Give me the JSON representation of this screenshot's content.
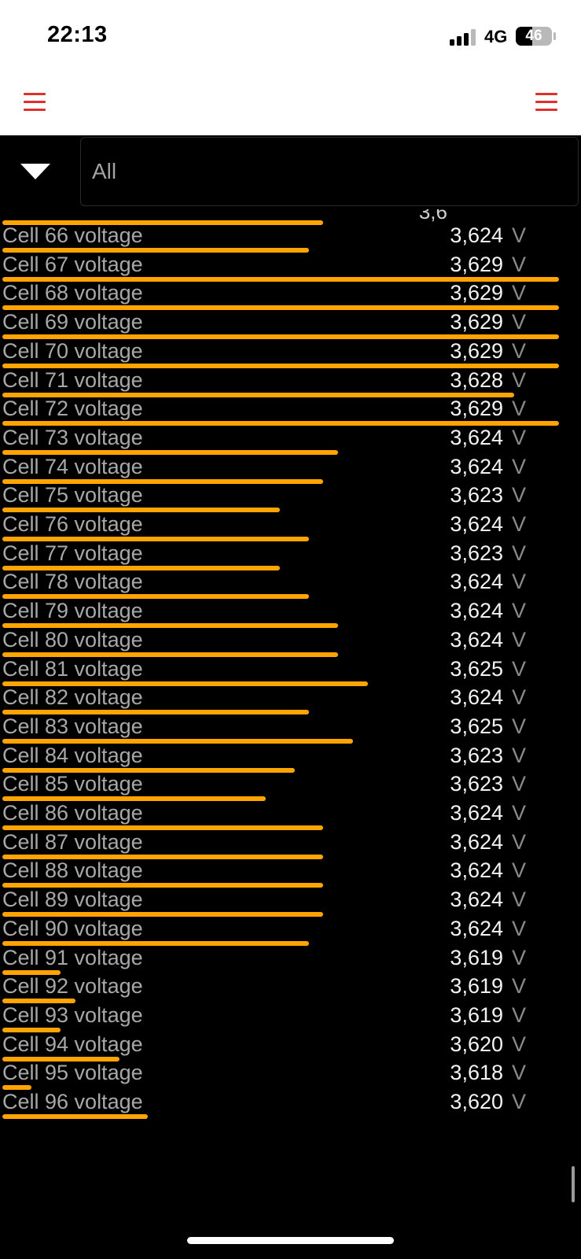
{
  "status_bar": {
    "time": "22:13",
    "network": "4G",
    "battery_level": "46",
    "battery_fraction": 0.46,
    "signal_bars_active": 3,
    "signal_bars_total": 4
  },
  "header": {
    "left_menu_icon": "hamburger-menu-icon",
    "right_menu_icon": "hamburger-menu-icon",
    "accent_color": "#e0302c"
  },
  "filter": {
    "dropdown_icon": "triangle-down-icon",
    "value": "All"
  },
  "colors": {
    "bar": "#ffa400",
    "background": "#000000"
  },
  "partial_top_row": {
    "value": "3,6",
    "bar_fraction": 0.555
  },
  "cells": [
    {
      "label": "Cell 66 voltage",
      "value": "3,624",
      "unit": "V",
      "bar_fraction": 0.53
    },
    {
      "label": "Cell 67 voltage",
      "value": "3,629",
      "unit": "V",
      "bar_fraction": 0.962
    },
    {
      "label": "Cell 68 voltage",
      "value": "3,629",
      "unit": "V",
      "bar_fraction": 0.962
    },
    {
      "label": "Cell 69 voltage",
      "value": "3,629",
      "unit": "V",
      "bar_fraction": 0.962
    },
    {
      "label": "Cell 70 voltage",
      "value": "3,629",
      "unit": "V",
      "bar_fraction": 0.962
    },
    {
      "label": "Cell 71 voltage",
      "value": "3,628",
      "unit": "V",
      "bar_fraction": 0.885
    },
    {
      "label": "Cell 72 voltage",
      "value": "3,629",
      "unit": "V",
      "bar_fraction": 0.962
    },
    {
      "label": "Cell 73 voltage",
      "value": "3,624",
      "unit": "V",
      "bar_fraction": 0.58
    },
    {
      "label": "Cell 74 voltage",
      "value": "3,624",
      "unit": "V",
      "bar_fraction": 0.555
    },
    {
      "label": "Cell 75 voltage",
      "value": "3,623",
      "unit": "V",
      "bar_fraction": 0.48
    },
    {
      "label": "Cell 76 voltage",
      "value": "3,624",
      "unit": "V",
      "bar_fraction": 0.53
    },
    {
      "label": "Cell 77 voltage",
      "value": "3,623",
      "unit": "V",
      "bar_fraction": 0.48
    },
    {
      "label": "Cell 78 voltage",
      "value": "3,624",
      "unit": "V",
      "bar_fraction": 0.53
    },
    {
      "label": "Cell 79 voltage",
      "value": "3,624",
      "unit": "V",
      "bar_fraction": 0.58
    },
    {
      "label": "Cell 80 voltage",
      "value": "3,624",
      "unit": "V",
      "bar_fraction": 0.58
    },
    {
      "label": "Cell 81 voltage",
      "value": "3,625",
      "unit": "V",
      "bar_fraction": 0.632
    },
    {
      "label": "Cell 82 voltage",
      "value": "3,624",
      "unit": "V",
      "bar_fraction": 0.53
    },
    {
      "label": "Cell 83 voltage",
      "value": "3,625",
      "unit": "V",
      "bar_fraction": 0.606
    },
    {
      "label": "Cell 84 voltage",
      "value": "3,623",
      "unit": "V",
      "bar_fraction": 0.505
    },
    {
      "label": "Cell 85 voltage",
      "value": "3,623",
      "unit": "V",
      "bar_fraction": 0.455
    },
    {
      "label": "Cell 86 voltage",
      "value": "3,624",
      "unit": "V",
      "bar_fraction": 0.555
    },
    {
      "label": "Cell 87 voltage",
      "value": "3,624",
      "unit": "V",
      "bar_fraction": 0.555
    },
    {
      "label": "Cell 88 voltage",
      "value": "3,624",
      "unit": "V",
      "bar_fraction": 0.555
    },
    {
      "label": "Cell 89 voltage",
      "value": "3,624",
      "unit": "V",
      "bar_fraction": 0.555
    },
    {
      "label": "Cell 90 voltage",
      "value": "3,624",
      "unit": "V",
      "bar_fraction": 0.53
    },
    {
      "label": "Cell 91 voltage",
      "value": "3,619",
      "unit": "V",
      "bar_fraction": 0.101
    },
    {
      "label": "Cell 92 voltage",
      "value": "3,619",
      "unit": "V",
      "bar_fraction": 0.126
    },
    {
      "label": "Cell 93 voltage",
      "value": "3,619",
      "unit": "V",
      "bar_fraction": 0.101
    },
    {
      "label": "Cell 94 voltage",
      "value": "3,620",
      "unit": "V",
      "bar_fraction": 0.202
    },
    {
      "label": "Cell 95 voltage",
      "value": "3,618",
      "unit": "V",
      "bar_fraction": 0.05
    },
    {
      "label": "Cell 96 voltage",
      "value": "3,620",
      "unit": "V",
      "bar_fraction": 0.252
    }
  ]
}
